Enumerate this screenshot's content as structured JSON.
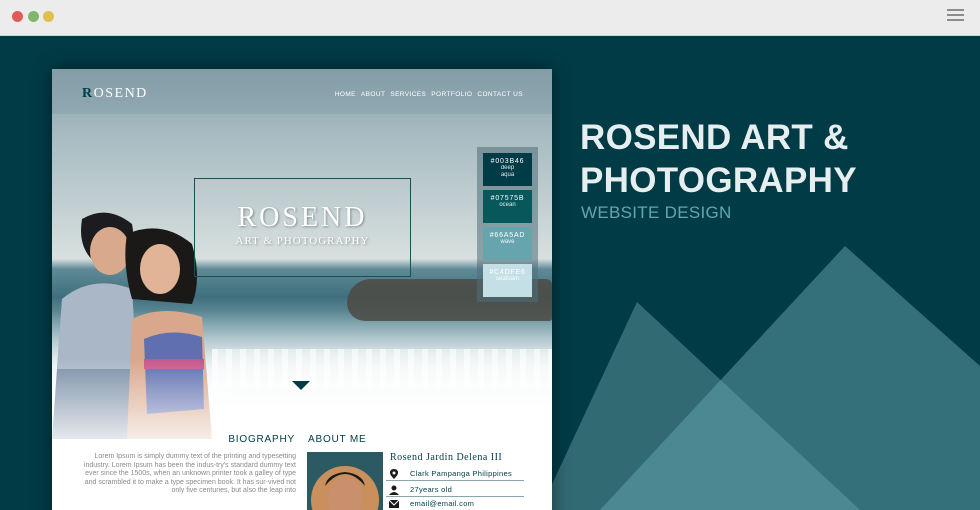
{
  "browser": {
    "window_controls": [
      "close",
      "minimize",
      "maximize"
    ],
    "menu_icon": "hamburger-menu-icon"
  },
  "headline": {
    "title_line1": "ROSEND ART &",
    "title_line2": "PHOTOGRAPHY",
    "subtitle": "WEBSITE DESIGN"
  },
  "mockup": {
    "logo_initial": "R",
    "logo_rest": "OSEND",
    "nav": [
      "HOME",
      "ABOUT",
      "SERVICES",
      "PORTFOLIO",
      "CONTACT US"
    ],
    "brand_title": "ROSEND",
    "brand_subtitle": "ART & PHOTOGRAPHY",
    "palette": [
      {
        "hex": "#003B46",
        "name_line1": "deep",
        "name_line2": "aqua",
        "color": "#003b46"
      },
      {
        "hex": "#07575B",
        "name_line1": "ocean",
        "name_line2": "",
        "color": "#07575b"
      },
      {
        "hex": "#66A5AD",
        "name_line1": "wave",
        "name_line2": "",
        "color": "#66a5ad"
      },
      {
        "hex": "#C4DFE6",
        "name_line1": "seafoam",
        "name_line2": "",
        "color": "#c4dfe6"
      }
    ],
    "biography_title": "BIOGRAPHY",
    "biography_text": "Lorem Ipsum is simply dummy text of the printing and typesetting industry. Lorem Ipsum has been the indus-try's standard dummy text ever since the 1500s, when an unknown printer took a galley of type and scrambled it to make a type specimen book. It has sur-vived not only five centuries, but also the leap into",
    "about_title": "ABOUT ME",
    "name": "Rosend Jardin Delena III",
    "location": "Clark Pampanga Philippines",
    "age": "27years old",
    "email": "email@email.com"
  },
  "colors": {
    "background": "#003b46",
    "accent": "#66a5ad",
    "ocean": "#07575b"
  }
}
